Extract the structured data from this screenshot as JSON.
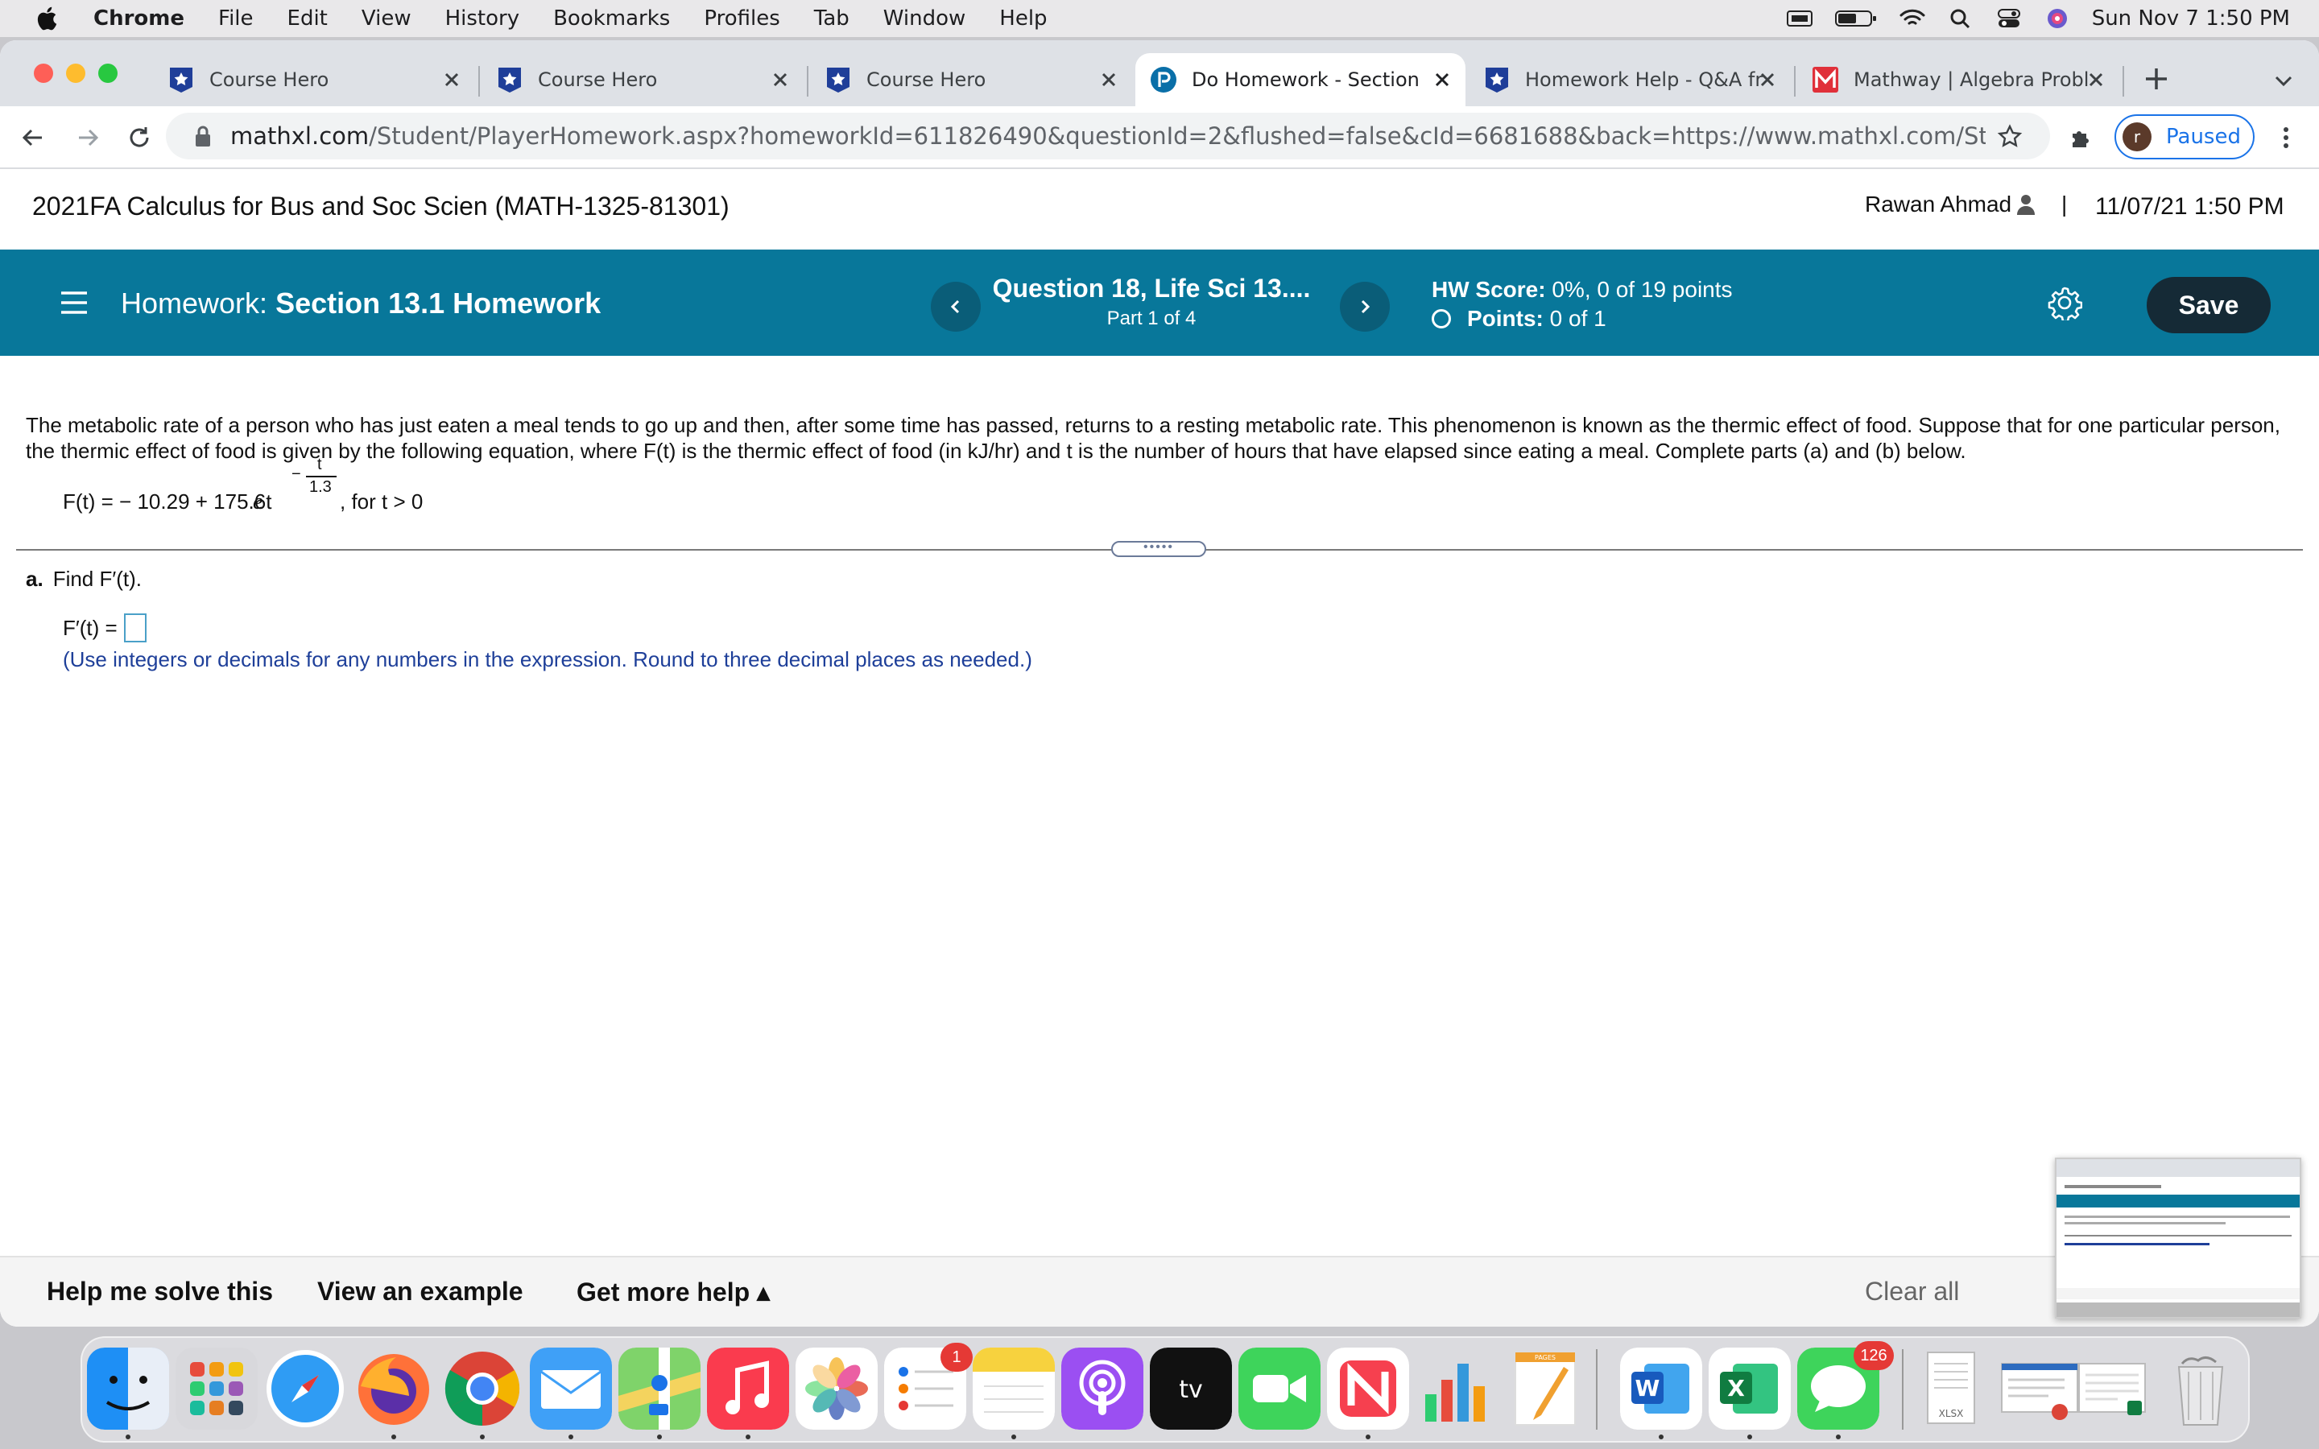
{
  "menubar": {
    "app": "Chrome",
    "items": [
      "File",
      "Edit",
      "View",
      "History",
      "Bookmarks",
      "Profiles",
      "Tab",
      "Window",
      "Help"
    ],
    "clock": "Sun Nov 7  1:50 PM"
  },
  "tabs": [
    {
      "title": "Course Hero",
      "icon": "course-hero-icon"
    },
    {
      "title": "Course Hero",
      "icon": "course-hero-icon"
    },
    {
      "title": "Course Hero",
      "icon": "course-hero-icon"
    },
    {
      "title": "Do Homework - Section",
      "icon": "pearson-icon",
      "active": true
    },
    {
      "title": "Homework Help - Q&A fr",
      "icon": "course-hero-icon"
    },
    {
      "title": "Mathway | Algebra Probl",
      "icon": "mathway-icon"
    }
  ],
  "address": {
    "host": "mathxl.com",
    "path": "/Student/PlayerHomework.aspx?homeworkId=611826490&questionId=2&flushed=false&cId=6681688&back=https://www.mathxl.com/Student/DoAssig..."
  },
  "profile": {
    "initial": "r",
    "status": "Paused"
  },
  "course": {
    "title": "2021FA Calculus for Bus and Soc Scien (MATH-1325-81301)",
    "user": "Rawan Ahmad",
    "separator": "|",
    "datetime": "11/07/21 1:50 PM"
  },
  "homework": {
    "label": "Homework:",
    "name": "Section 13.1 Homework",
    "question_title": "Question 18, Life Sci 13....",
    "question_part": "Part 1 of 4",
    "score_label": "HW Score:",
    "score_value": "0%, 0 of 19 points",
    "points_label": "Points:",
    "points_value": "0 of 1",
    "save": "Save"
  },
  "question": {
    "prompt": "The metabolic rate of a person who has just eaten a meal tends to go up and then, after some time has passed, returns to a resting metabolic rate. This phenomenon is known as the thermic effect of food. Suppose that for one particular person, the thermic effect of food is given by the following equation, where F(t) is the thermic effect of food (in kJ/hr) and t is the number of hours that have elapsed since eating a meal. Complete parts (a) and (b) below.",
    "eq_lhs": "F(t) = − 10.29 + 175.6t",
    "eq_base": "e",
    "eq_exp_sign": "−",
    "eq_exp_num": "t",
    "eq_exp_den": "1.3",
    "eq_tail": ", for t > 0",
    "splitter": "•••••",
    "part_letter": "a.",
    "part_text": "Find F′(t).",
    "answer_label": "F′(t) =",
    "instructions": "(Use integers or decimals for any numbers in the expression. Round to three decimal places as needed.)"
  },
  "help": {
    "solve": "Help me solve this",
    "example": "View an example",
    "more": "Get more help ▴",
    "clear": "Clear all"
  },
  "dock": {
    "reminders_badge": "1",
    "messages_badge": "126",
    "pages_label": "PAGES",
    "xlsx_label": "XLSX"
  }
}
